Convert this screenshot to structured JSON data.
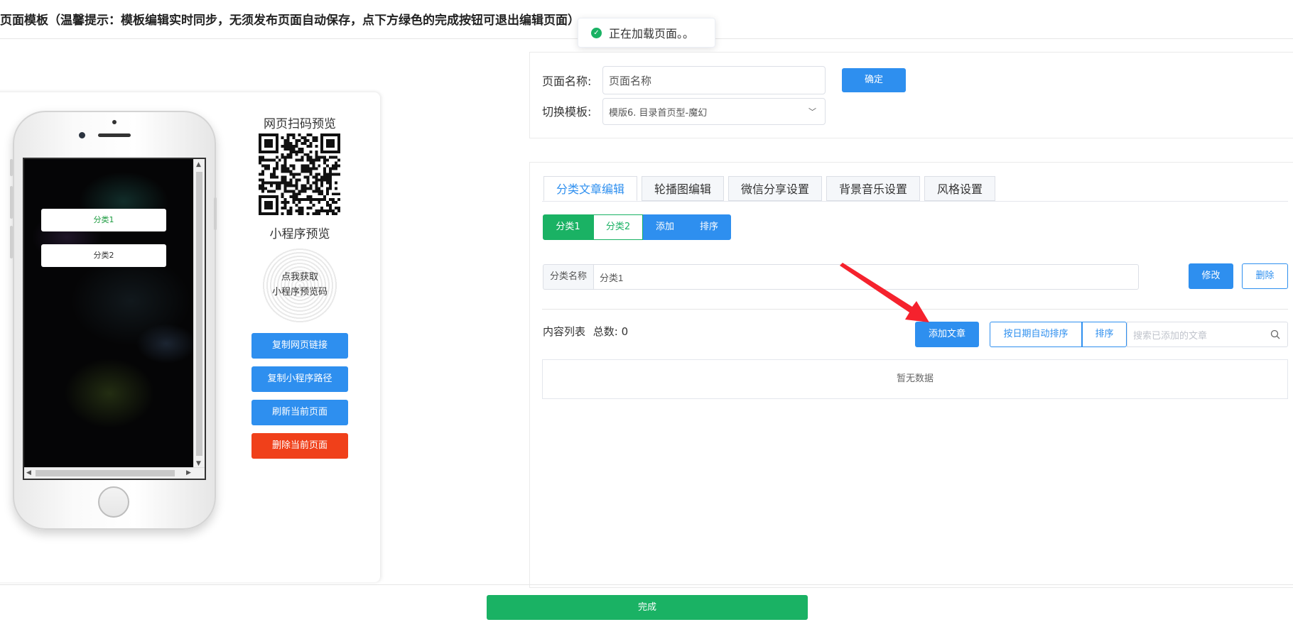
{
  "header": {
    "title": "页面模板（温馨提示：模板编辑实时同步，无须发布页面自动保存，点下方绿色的完成按钮可退出编辑页面）"
  },
  "toast": {
    "message": "正在加载页面。。"
  },
  "preview": {
    "web_qr_title": "网页扫码预览",
    "mini_title": "小程序预览",
    "mini_qr_text_line1": "点我获取",
    "mini_qr_text_line2": "小程序预览码",
    "phone_categories": [
      "分类1",
      "分类2"
    ],
    "buttons": {
      "copy_web_link": "复制网页链接",
      "copy_mini_path": "复制小程序路径",
      "refresh_page": "刷新当前页面",
      "delete_page": "删除当前页面"
    }
  },
  "form": {
    "page_name_label": "页面名称:",
    "page_name_value": "页面名称",
    "confirm_label": "确定",
    "template_label": "切换模板:",
    "template_value": "模版6. 目录首页型-魔幻"
  },
  "tabs": [
    "分类文章编辑",
    "轮播图编辑",
    "微信分享设置",
    "背景音乐设置",
    "风格设置"
  ],
  "categories": {
    "items": [
      "分类1",
      "分类2"
    ],
    "add_label": "添加",
    "sort_label": "排序"
  },
  "category_name": {
    "label": "分类名称",
    "value": "分类1",
    "edit_label": "修改",
    "delete_label": "删除"
  },
  "content_list": {
    "label": "内容列表",
    "total_label": "总数:",
    "total_value": "0",
    "add_article_label": "添加文章",
    "auto_sort_label": "按日期自动排序",
    "sort_label": "排序",
    "search_placeholder": "搜索已添加的文章",
    "empty_text": "暂无数据"
  },
  "footer": {
    "done_label": "完成"
  },
  "colors": {
    "primary": "#2e8fef",
    "success": "#1ab264",
    "danger": "#f0401a",
    "annotation_arrow": "#f5222d"
  }
}
